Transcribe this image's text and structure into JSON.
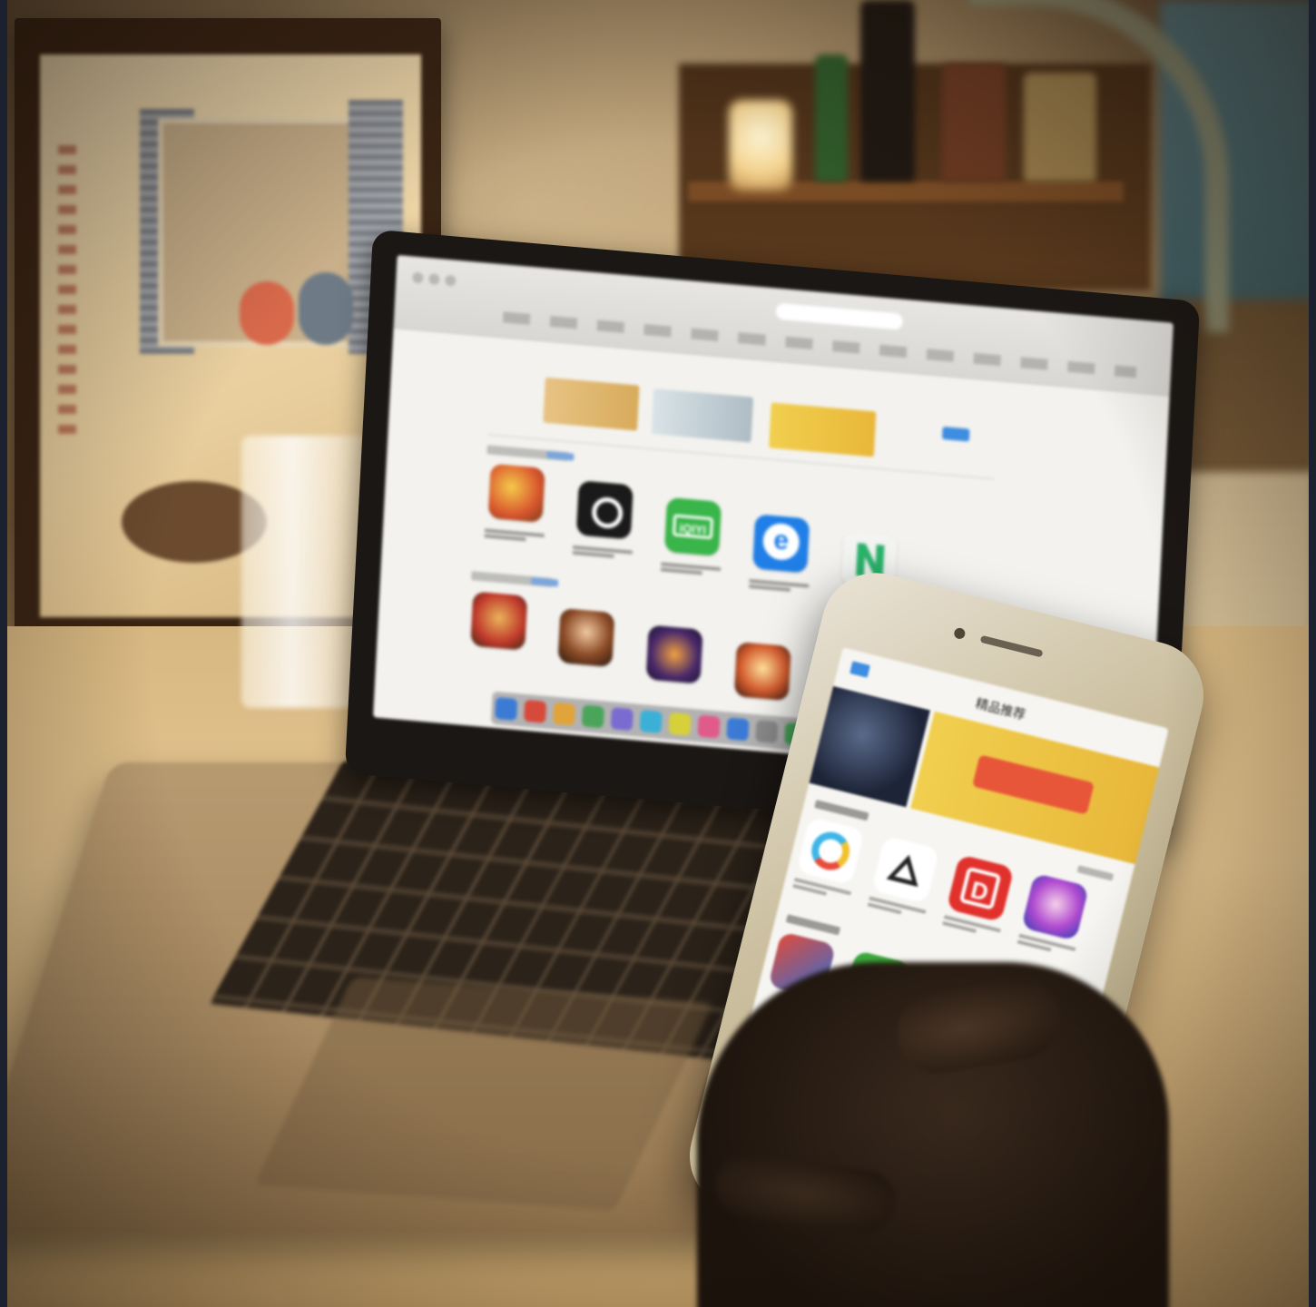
{
  "scene": {
    "laptop_screen": {
      "title": "",
      "row1_apps": [
        {
          "icon": "food-game-icon",
          "text": ""
        },
        {
          "icon": "uber-icon",
          "text": ""
        },
        {
          "icon": "iqiyi-icon",
          "text": "iQIYI"
        },
        {
          "icon": "eleme-icon",
          "text": "e"
        },
        {
          "icon": "navigation-app-icon",
          "text": ""
        }
      ],
      "row2_apps": [
        {
          "icon": "game-icon"
        },
        {
          "icon": "game-icon"
        },
        {
          "icon": "game-icon"
        },
        {
          "icon": "game-icon"
        }
      ]
    },
    "phone_screen": {
      "nav_title": "精品推荐",
      "row1_apps": [
        {
          "icon": "c-logo-icon",
          "text": ""
        },
        {
          "icon": "triangle-logo-icon",
          "text": ""
        },
        {
          "icon": "d-logo-icon",
          "text": "D"
        },
        {
          "icon": "face-game-icon",
          "text": ""
        }
      ],
      "row2_apps": [
        {
          "icon": "game-icon"
        },
        {
          "icon": "bat-game-icon"
        },
        {
          "icon": "game-icon"
        },
        {
          "icon": "game-icon"
        }
      ]
    }
  },
  "colors": {
    "accent_blue": "#3e8de0",
    "iqiyi_green": "#3ab54a",
    "eleme_blue": "#1f7fe6",
    "d_red": "#e1312c"
  }
}
